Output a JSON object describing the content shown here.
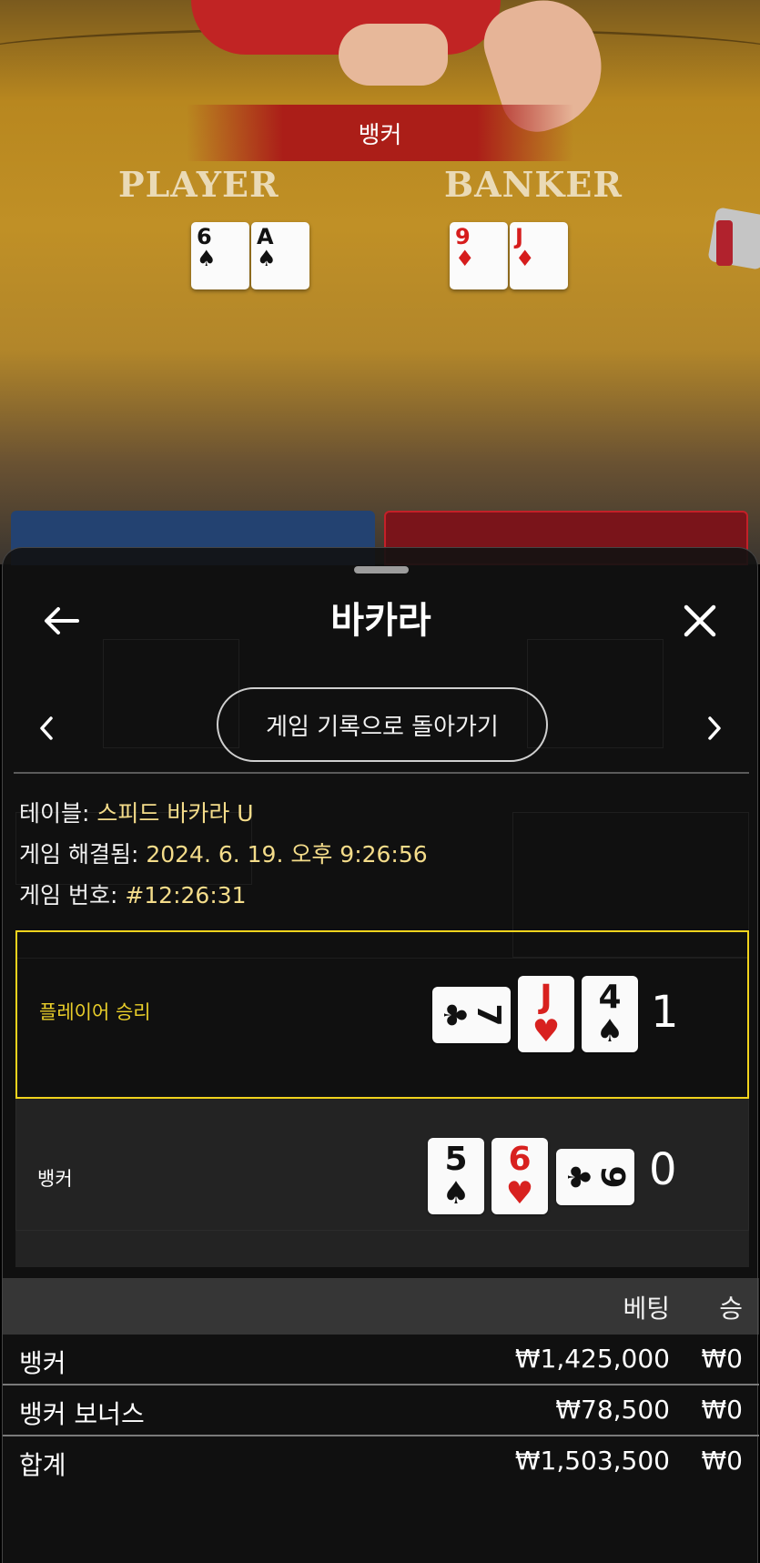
{
  "table_view": {
    "result_banner": "뱅커",
    "player_label": "PLAYER",
    "banker_label": "BANKER",
    "player_cards": [
      {
        "rank": "6",
        "suit": "♠",
        "color": "black"
      },
      {
        "rank": "A",
        "suit": "♠",
        "color": "black"
      }
    ],
    "banker_cards": [
      {
        "rank": "9",
        "suit": "♦",
        "color": "red"
      },
      {
        "rank": "J",
        "suit": "♦",
        "color": "red"
      }
    ]
  },
  "sheet": {
    "title": "바카라",
    "back_icon": "arrow-left-icon",
    "close_icon": "close-icon",
    "return_button": "게임 기록으로 돌아가기",
    "info": {
      "table_key": "테이블: ",
      "table_value": "스피드 바카라 U",
      "resolved_key": "게임 해결됨: ",
      "resolved_value": "2024. 6. 19. 오후 9:26:56",
      "number_key": "게임 번호: ",
      "number_value": "#12:26:31"
    },
    "player_hand": {
      "label": "플레이어 승리",
      "score": "1",
      "cards": [
        {
          "rank": "7",
          "suit": "♣",
          "color": "black",
          "orientation": "horizontal"
        },
        {
          "rank": "J",
          "suit": "♥",
          "color": "red",
          "orientation": "vertical"
        },
        {
          "rank": "4",
          "suit": "♠",
          "color": "black",
          "orientation": "vertical"
        }
      ]
    },
    "banker_hand": {
      "label": "뱅커",
      "score": "0",
      "cards": [
        {
          "rank": "5",
          "suit": "♠",
          "color": "black",
          "orientation": "vertical"
        },
        {
          "rank": "6",
          "suit": "♥",
          "color": "red",
          "orientation": "vertical"
        },
        {
          "rank": "9",
          "suit": "♣",
          "color": "black",
          "orientation": "horizontal"
        }
      ]
    },
    "bets": {
      "col_bet": "베팅",
      "col_win": "승",
      "rows": [
        {
          "name": "뱅커",
          "amount": "₩1,425,000",
          "win": "₩0"
        },
        {
          "name": "뱅커 보너스",
          "amount": "₩78,500",
          "win": "₩0"
        },
        {
          "name": "합계",
          "amount": "₩1,503,500",
          "win": "₩0"
        }
      ]
    }
  },
  "colors": {
    "winner_border": "#f1d31d",
    "info_value": "#f4dc8a",
    "banker_red": "#c42028",
    "player_blue": "#234271"
  }
}
